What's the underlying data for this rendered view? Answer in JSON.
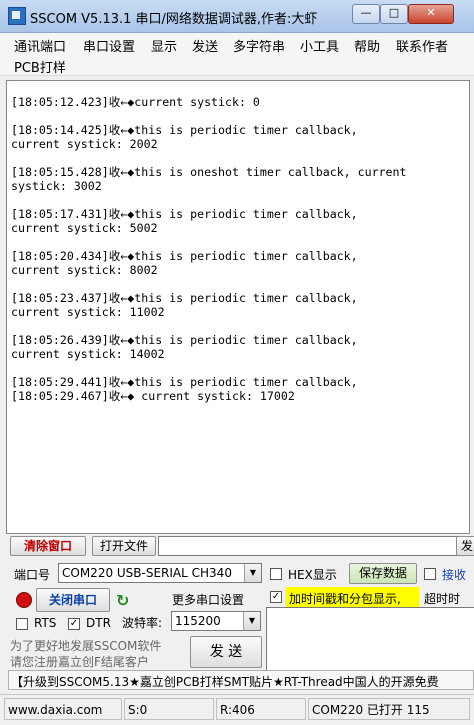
{
  "window": {
    "title": "SSCOM V5.13.1 串口/网络数据调试器,作者:大虾",
    "min_label": "—",
    "max_label": "□",
    "close_label": "✕"
  },
  "menu": {
    "items": [
      "通讯端口",
      "串口设置",
      "显示",
      "发送",
      "多字符串",
      "小工具",
      "帮助",
      "联系作者",
      "PCB打样"
    ]
  },
  "receive": {
    "text": "[18:05:12.423]收←◆current systick: 0\n\n[18:05:14.425]收←◆this is periodic timer callback,\ncurrent systick: 2002\n\n[18:05:15.428]收←◆this is oneshot timer callback, current\nsystick: 3002\n\n[18:05:17.431]收←◆this is periodic timer callback,\ncurrent systick: 5002\n\n[18:05:20.434]收←◆this is periodic timer callback,\ncurrent systick: 8002\n\n[18:05:23.437]收←◆this is periodic timer callback,\ncurrent systick: 11002\n\n[18:05:26.439]收←◆this is periodic timer callback,\ncurrent systick: 14002\n\n[18:05:29.441]收←◆this is periodic timer callback,\n[18:05:29.467]收←◆ current systick: 17002"
  },
  "toolbar": {
    "clear_label": "清除窗口",
    "open_file_label": "打开文件",
    "send_file_label": "发"
  },
  "port": {
    "label": "端口号",
    "value": "COM220 USB-SERIAL CH340",
    "hex_display_label": "HEX显示",
    "save_data_label": "保存数据",
    "receive_label": "接收"
  },
  "controls": {
    "close_port_label": "关闭串口",
    "more_settings_label": "更多串口设置",
    "timestamp_label": "加时间戳和分包显示,",
    "timeout_label": "超时时",
    "rts_label": "RTS",
    "dtr_label": "DTR",
    "dtr_check": "✓",
    "timestamp_check": "✓",
    "baud_label": "波特率:",
    "baud_value": "115200",
    "refresh_icon": "↻"
  },
  "promo": {
    "line1": "为了更好地发展SSCOM软件",
    "line2": "请您注册嘉立创F结尾客户",
    "send_label": "发  送"
  },
  "banner": {
    "text": "【升级到SSCOM5.13★嘉立创PCB打样SMT贴片★RT-Thread中国人的开源免费"
  },
  "status": {
    "website": "www.daxia.com",
    "sent": "S:0",
    "received": "R:406",
    "port_state": "COM220 已打开  115"
  }
}
